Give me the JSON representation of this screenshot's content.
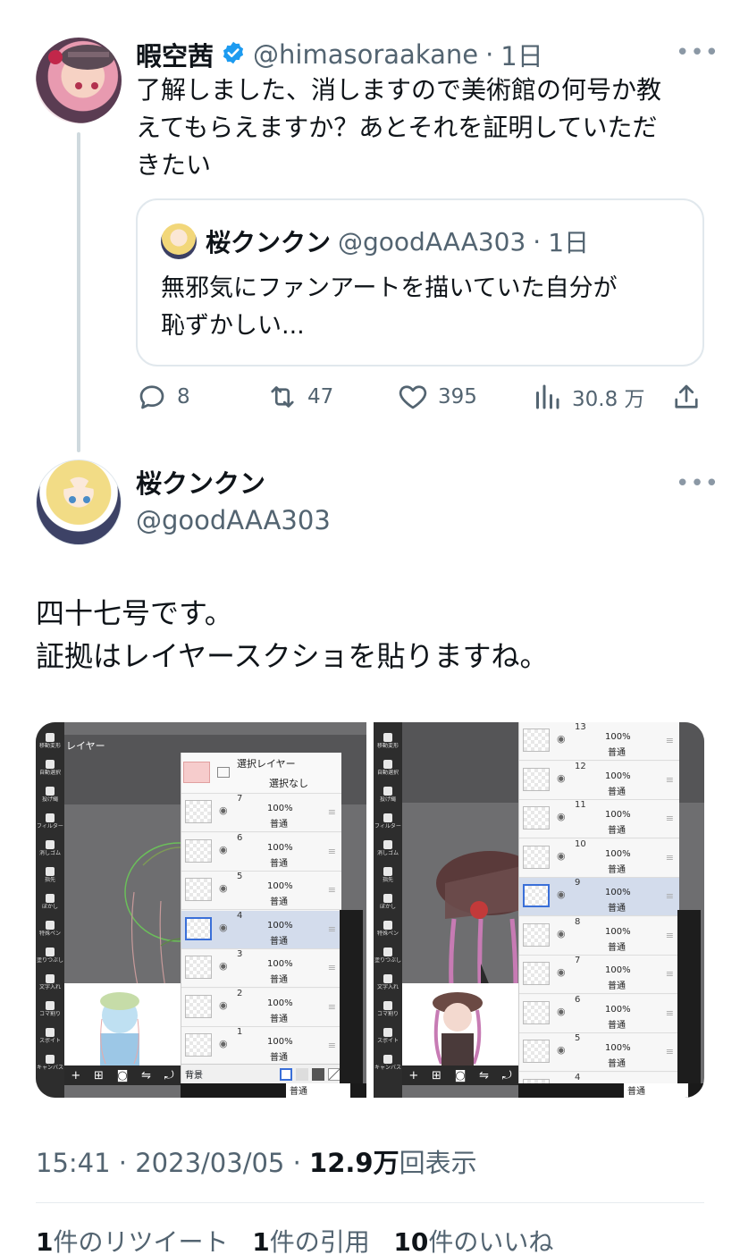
{
  "reply_tweet": {
    "display_name": "暇空茜",
    "handle": "@himasoraakane",
    "time_sep": "·",
    "time": "1日",
    "text_lines": [
      "了解しました、消しますので美術館の何号か教",
      "えてもらえますか？あとそれを証明していただ",
      "きたい"
    ],
    "more_icon": "more-horizontal-icon",
    "verified_icon": "verified-badge-icon",
    "verified_color": "#1d9bf0"
  },
  "quote": {
    "display_name": "桜クンクン",
    "handle": "@goodAAA303",
    "time_sep": "·",
    "time": "1日",
    "text_lines": [
      "無邪気にファンアートを描いていた自分が",
      "恥ずかしい..."
    ]
  },
  "actions": {
    "replies": "8",
    "retweets": "47",
    "likes": "395",
    "views": "30.8 万"
  },
  "main_tweet": {
    "display_name": "桜クンクン",
    "handle": "@goodAAA303",
    "text_lines": [
      "四十七号です。",
      "証拠はレイヤースクショを貼りますね。"
    ]
  },
  "screenshot_left": {
    "header": "レイヤー",
    "panel_title": "選択レイヤー",
    "none_label": "選択なし",
    "background_label": "背景",
    "mode_footer": "普通",
    "tools": [
      "移動変形",
      "自動選択",
      "投げ縄",
      "フィルター",
      "消しゴム",
      "指先",
      "ぼかし",
      "特殊ペン",
      "塗りつぶし",
      "文字入れ",
      "コマ割り",
      "スポイト",
      "キャンバス"
    ],
    "layers": [
      {
        "num": "7",
        "opacity": "100%",
        "mode": "普通",
        "selected": false
      },
      {
        "num": "6",
        "opacity": "100%",
        "mode": "普通",
        "selected": false
      },
      {
        "num": "5",
        "opacity": "100%",
        "mode": "普通",
        "selected": false
      },
      {
        "num": "4",
        "opacity": "100%",
        "mode": "普通",
        "selected": true
      },
      {
        "num": "3",
        "opacity": "100%",
        "mode": "普通",
        "selected": false
      },
      {
        "num": "2",
        "opacity": "100%",
        "mode": "普通",
        "selected": false
      },
      {
        "num": "1",
        "opacity": "100%",
        "mode": "普通",
        "selected": false
      }
    ]
  },
  "screenshot_right": {
    "mode_footer": "普通",
    "layers": [
      {
        "num": "13",
        "opacity": "100%",
        "mode": "普通",
        "selected": false
      },
      {
        "num": "12",
        "opacity": "100%",
        "mode": "普通",
        "selected": false
      },
      {
        "num": "11",
        "opacity": "100%",
        "mode": "普通",
        "selected": false
      },
      {
        "num": "10",
        "opacity": "100%",
        "mode": "普通",
        "selected": false
      },
      {
        "num": "9",
        "opacity": "100%",
        "mode": "普通",
        "selected": true
      },
      {
        "num": "8",
        "opacity": "100%",
        "mode": "普通",
        "selected": false
      },
      {
        "num": "7",
        "opacity": "100%",
        "mode": "普通",
        "selected": false
      },
      {
        "num": "6",
        "opacity": "100%",
        "mode": "普通",
        "selected": false
      },
      {
        "num": "5",
        "opacity": "100%",
        "mode": "普通",
        "selected": false
      },
      {
        "num": "4",
        "opacity": "",
        "mode": "",
        "selected": false
      }
    ]
  },
  "meta": {
    "time": "15:41",
    "sep": "·",
    "date": "2023/03/05",
    "views_count": "12.9万",
    "views_label": "回表示"
  },
  "stats": {
    "retweets_count": "1",
    "retweets_label": "件のリツイート",
    "quotes_count": "1",
    "quotes_label": "件の引用",
    "likes_count": "10",
    "likes_label": "件のいいね"
  }
}
